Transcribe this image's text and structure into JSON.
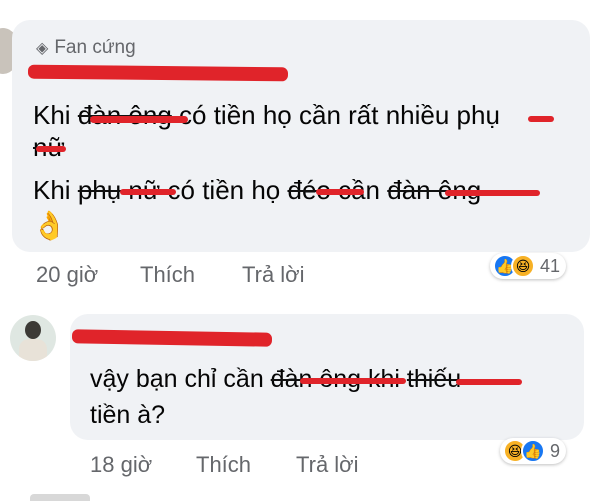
{
  "comment1": {
    "badge": "Fan cứng",
    "line1": {
      "pre": "Khi ",
      "struck": "đàn ông",
      "post": " có tiền họ cần rất nhiều phụ"
    },
    "line2": {
      "struck": "nữ"
    },
    "line3": {
      "pre": "Khi ",
      "struck1": "phụ nữ",
      "mid1": " có tiền họ ",
      "struck2": "đéo",
      "mid2": " cần ",
      "struck3": "đàn ông"
    },
    "emoji": "👌",
    "time": "20 giờ",
    "like": "Thích",
    "reply": "Trả lời",
    "reaction_count": "41",
    "reaction_icons": [
      "like-icon",
      "haha-icon"
    ]
  },
  "comment2": {
    "line1": {
      "pre": "vậy bạn chỉ cần ",
      "struck1": "đàn ông",
      "mid": " khi ",
      "struck2": "thiếu"
    },
    "line2": "tiền à?",
    "time": "18 giờ",
    "like": "Thích",
    "reply": "Trả lời",
    "reaction_count": "9",
    "reaction_icons": [
      "haha-icon",
      "like-icon"
    ]
  },
  "colors": {
    "bubble": "#f0f2f5",
    "redact": "#e0242a",
    "meta": "#65676b",
    "like": "#1877f2"
  }
}
